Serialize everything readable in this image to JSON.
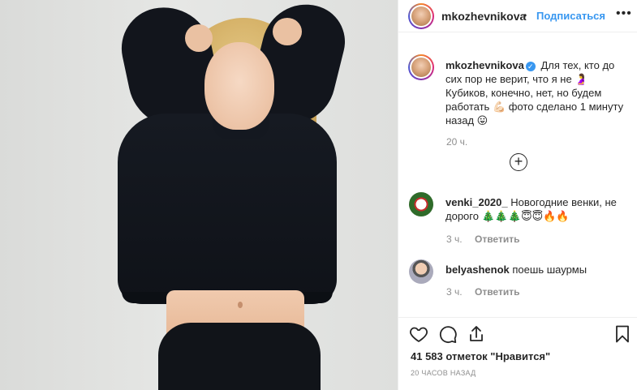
{
  "post": {
    "username": "mkozhevnikova",
    "follow_label": "Подписаться",
    "separator": "•",
    "more_label": "•••",
    "caption": {
      "username": "mkozhevnikova",
      "verified_mark": "✓",
      "text": "Для тех, кто до сих пор не верит, что я не 🤰 Кубиков, конечно, нет, но будем работать 💪🏻 фото сделано 1 минуту назад 😛",
      "time": "20 ч."
    },
    "load_more_icon": "plus-circle-icon",
    "load_more_glyph": "+",
    "comments": [
      {
        "username": "venki_2020_",
        "text": "Новогодние венки, не дорого 🎄🎄🎄😇😇🔥🔥",
        "time": "3 ч.",
        "reply": "Ответить"
      },
      {
        "username": "belyashenok",
        "text": "поешь шаурмы",
        "time": "3 ч.",
        "reply": "Ответить"
      }
    ],
    "likes": "41 583 отметок \"Нравится\"",
    "posted": "20 ЧАСОВ НАЗАД"
  },
  "icons": {
    "like": "heart-icon",
    "comment": "speech-bubble-icon",
    "share": "share-arrow-icon",
    "save": "bookmark-icon"
  },
  "colors": {
    "link": "#3897f0",
    "muted": "#8e8e8e",
    "text": "#262626"
  }
}
